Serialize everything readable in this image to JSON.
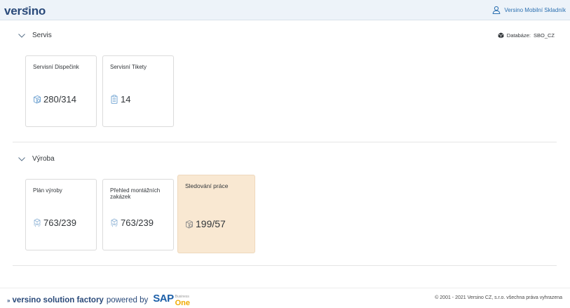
{
  "header": {
    "logo": "versino",
    "logo_mark": "»",
    "user_label": "Versino Mobilní Skladník"
  },
  "database": {
    "label": "Databáze:",
    "value": "SBO_CZ"
  },
  "sections": [
    {
      "title": "Servis",
      "tiles": [
        {
          "title": "Servisní Dispečink",
          "value": "280/314",
          "icon": "box-refresh-icon"
        },
        {
          "title": "Servisní Tikety",
          "value": "14",
          "icon": "clipboard-icon"
        }
      ]
    },
    {
      "title": "Výroba",
      "tiles": [
        {
          "title": "Plán výroby",
          "value": "763/239",
          "icon": "cubes-icon"
        },
        {
          "title": "Přehled montážních zakázek",
          "value": "763/239",
          "icon": "cubes-icon"
        },
        {
          "title": "Sledování práce",
          "value": "199/57",
          "icon": "box-refresh-icon",
          "highlighted": true
        }
      ]
    }
  ],
  "footer": {
    "brand_mark": "»",
    "brand_bold": "versino solution factory",
    "brand_rest": "powered by",
    "sap_text": "SAP",
    "sap_business": "Business",
    "sap_one": "One",
    "copyright": "© 2001 - 2021 Versino CZ, s.r.o. všechna práva vyhrazena"
  },
  "colors": {
    "shell_bg": "#edf3f9",
    "highlight_tile": "#f9e8d2",
    "link_blue": "#2a6fb0",
    "sap_blue": "#1c5fa8",
    "sap_gold": "#f0ab00"
  }
}
